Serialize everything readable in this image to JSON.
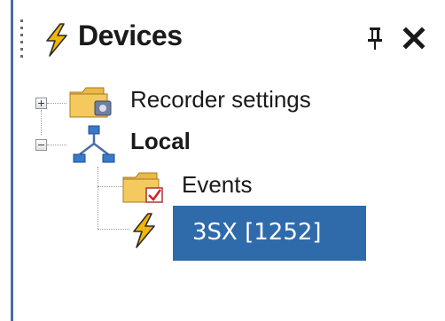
{
  "panel": {
    "title": "Devices",
    "title_icon": "lightning-bolt-icon",
    "pin_icon": "pin-icon",
    "close_icon": "close-icon"
  },
  "tree": {
    "items": [
      {
        "label": "Recorder settings",
        "icon": "folder-settings-icon",
        "expander": "plus",
        "bold": false
      },
      {
        "label": "Local",
        "icon": "network-icon",
        "expander": "minus",
        "bold": true
      },
      {
        "label": "Events",
        "icon": "folder-events-icon",
        "expander": null,
        "bold": false
      },
      {
        "label": "3SX [1252]",
        "icon": "lightning-bolt-icon",
        "expander": null,
        "bold": false,
        "selected": true
      }
    ]
  },
  "colors": {
    "selection": "#2f6bab",
    "edge": "#4a6ea8",
    "bolt": "#f2b705",
    "folder": "#f4c95d"
  }
}
